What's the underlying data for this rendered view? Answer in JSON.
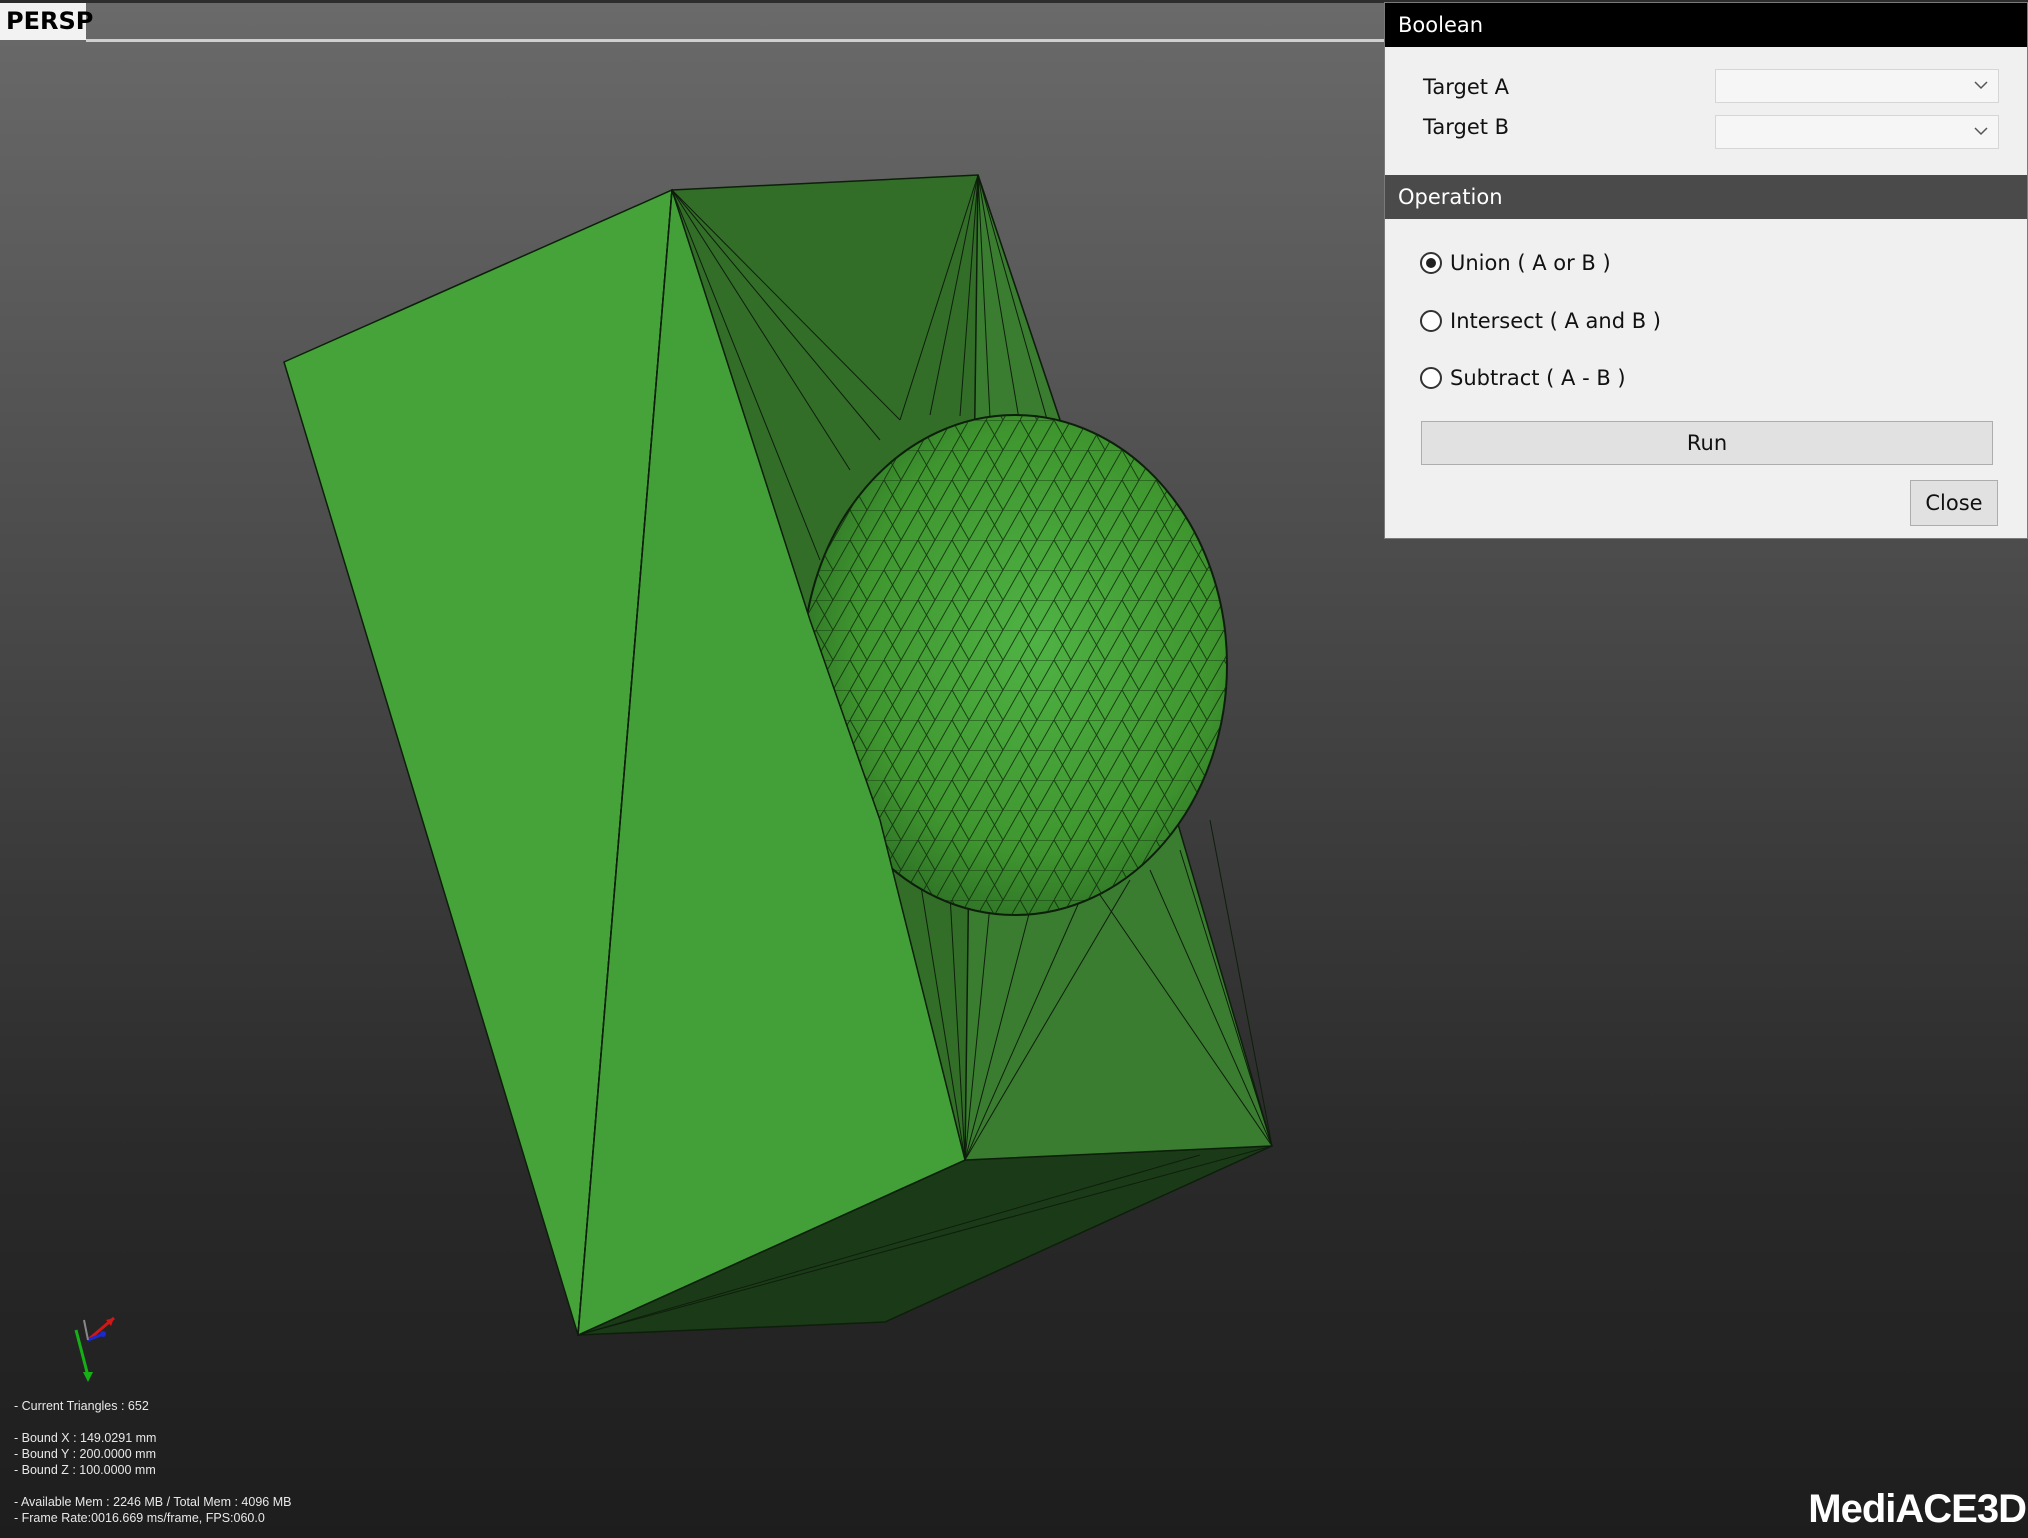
{
  "viewport": {
    "label": "PERSP"
  },
  "hud": {
    "triangles": "- Current Triangles : 652",
    "bound_x": "- Bound X : 149.0291 mm",
    "bound_y": "- Bound Y : 200.0000 mm",
    "bound_z": "- Bound Z : 100.0000 mm",
    "memory": "- Available Mem : 2246 MB / Total Mem : 4096 MB",
    "frame_rate": "- Frame Rate:0016.669 ms/frame, FPS:060.0"
  },
  "brand": "MediACE3D",
  "colors": {
    "mesh_light": "#45a33a",
    "mesh_mid": "#3a8a2f",
    "mesh_dark": "#2f6f27",
    "mesh_shadow": "#1a3a16",
    "panel_title_bg": "#000000",
    "panel_bg": "#f0f0f0"
  },
  "dialog": {
    "title": "Boolean",
    "target_a": {
      "label": "Target A",
      "value": ""
    },
    "target_b": {
      "label": "Target B",
      "value": ""
    },
    "operation_header": "Operation",
    "operations": [
      {
        "label": "Union ( A or B )",
        "checked": true
      },
      {
        "label": "Intersect ( A and B )",
        "checked": false
      },
      {
        "label": "Subtract ( A - B )",
        "checked": false
      }
    ],
    "run_label": "Run",
    "close_label": "Close"
  },
  "icons": {
    "combo_arrow": "chevron-down-icon",
    "axis": "axis-gizmo-icon"
  }
}
